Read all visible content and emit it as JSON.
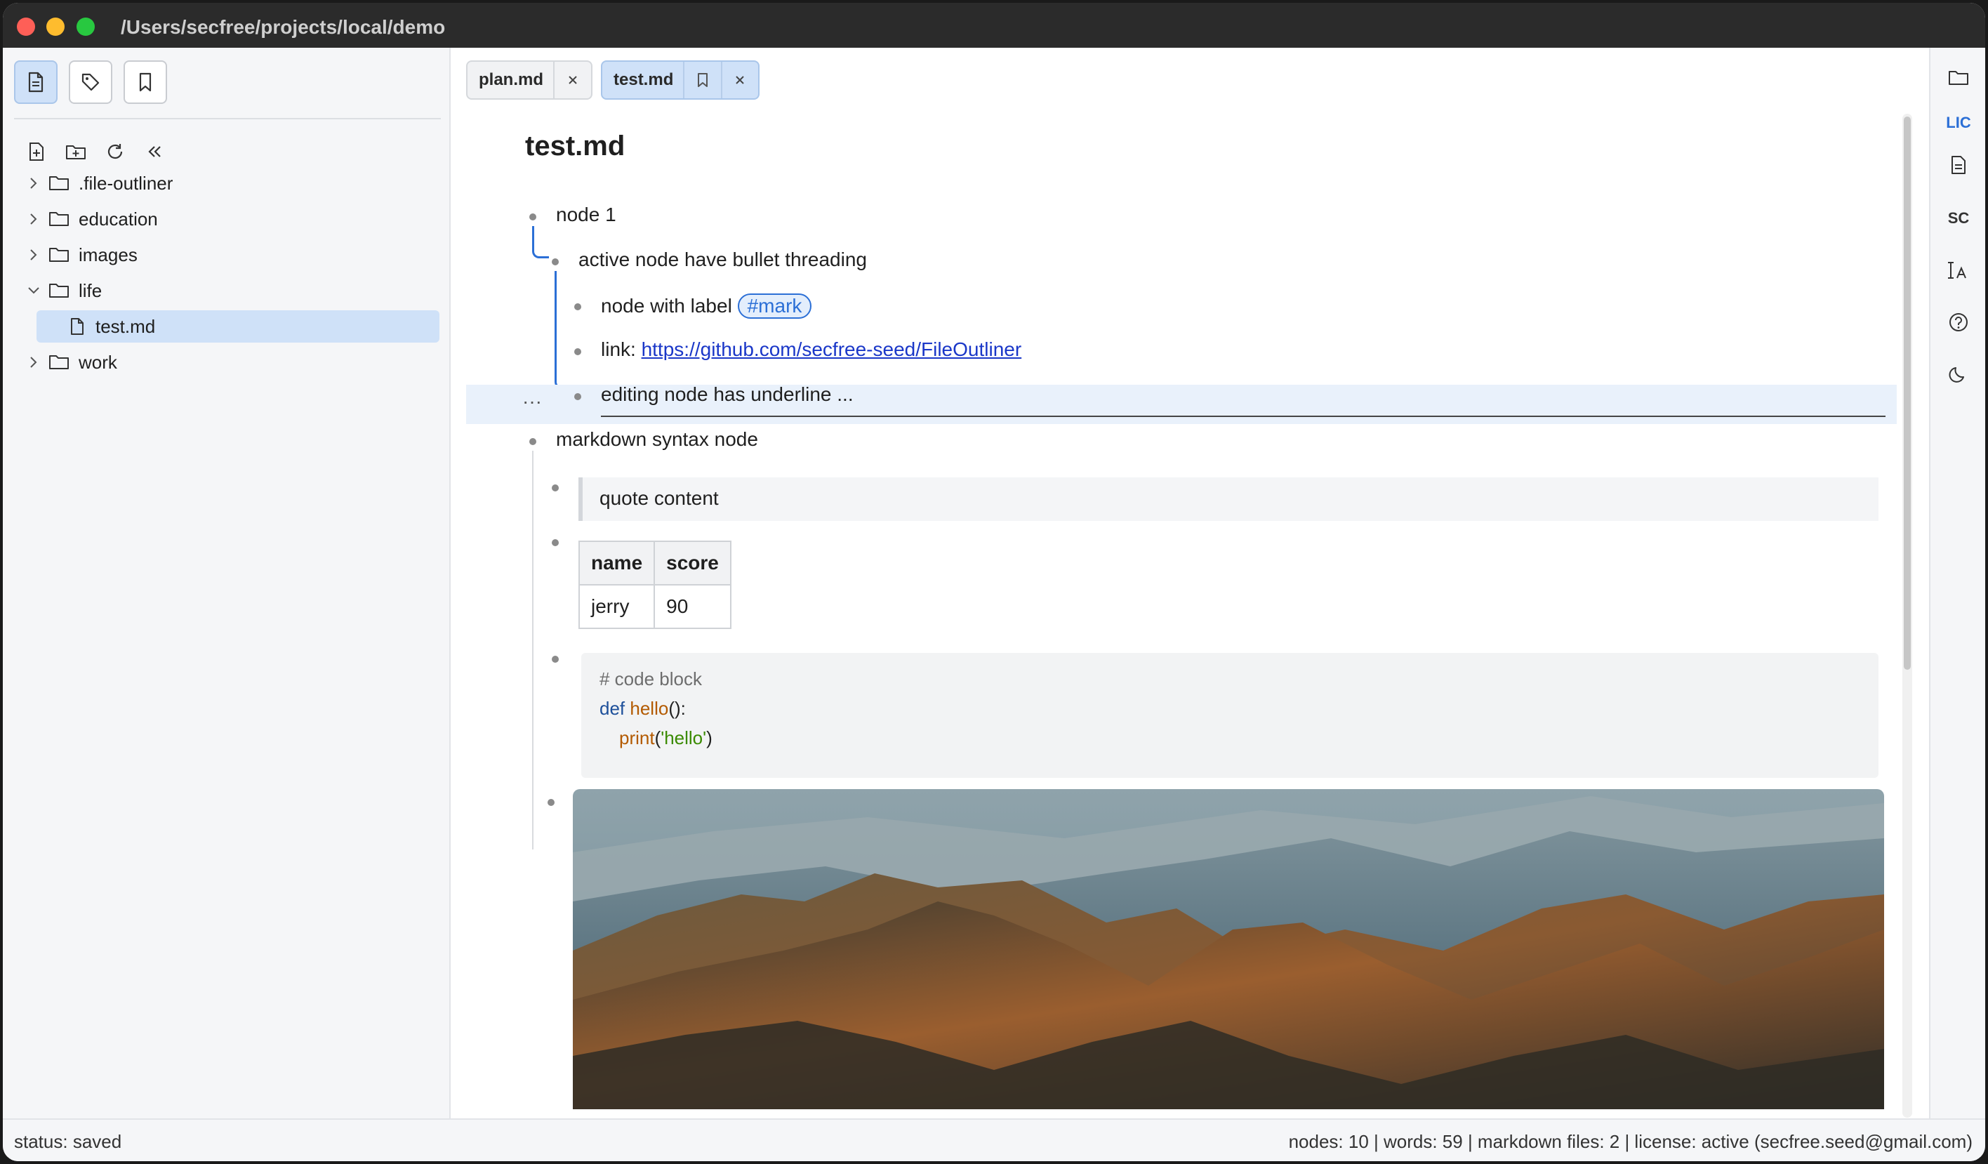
{
  "window": {
    "title": "/Users/secfree/projects/local/demo"
  },
  "sidebar": {
    "tabs": [
      {
        "icon": "file-icon",
        "active": true
      },
      {
        "icon": "tag-icon",
        "active": false
      },
      {
        "icon": "bookmark-icon",
        "active": false
      }
    ],
    "tools": [
      "new-file-icon",
      "new-folder-icon",
      "refresh-icon",
      "collapse-icon"
    ],
    "tree": [
      {
        "label": ".file-outliner",
        "type": "folder",
        "expanded": false
      },
      {
        "label": "education",
        "type": "folder",
        "expanded": false
      },
      {
        "label": "images",
        "type": "folder",
        "expanded": false
      },
      {
        "label": "life",
        "type": "folder",
        "expanded": true
      },
      {
        "label": "test.md",
        "type": "file",
        "selected": true
      },
      {
        "label": "work",
        "type": "folder",
        "expanded": false
      }
    ]
  },
  "tabs": [
    {
      "label": "plan.md",
      "active": false
    },
    {
      "label": "test.md",
      "active": true
    }
  ],
  "document": {
    "title": "test.md",
    "nodes": {
      "n1": "node 1",
      "n1_1": "active node have bullet threading",
      "n1_1_1": "node with label",
      "n1_1_1_tag": "#mark",
      "n1_1_2_prefix": "link:",
      "n1_1_2_link": "https://github.com/secfree-seed/FileOutliner",
      "n1_1_3": "editing node has underline ...",
      "more": "···",
      "n2": "markdown syntax node",
      "quote": "quote content",
      "table": {
        "headers": [
          "name",
          "score"
        ],
        "rows": [
          [
            "jerry",
            "90"
          ]
        ]
      },
      "code": {
        "comment": "# code block",
        "kw": "def",
        "fn": "hello",
        "sig": "():",
        "print": "print",
        "arg_open": "(",
        "str": "'hello'",
        "arg_close": ")"
      }
    }
  },
  "rail": {
    "items": [
      {
        "icon": "folder-icon"
      },
      {
        "label": "LIC",
        "color": "#2b6fd6"
      },
      {
        "icon": "document-icon"
      },
      {
        "label": "SC",
        "color": "#333333"
      },
      {
        "icon": "font-size-icon"
      },
      {
        "icon": "help-icon"
      },
      {
        "icon": "dark-mode-icon"
      }
    ]
  },
  "status": {
    "left": "status: saved",
    "right": "nodes: 10 | words: 59 | markdown files: 2 | license: active (secfree.seed@gmail.com)"
  },
  "colors": {
    "accent": "#2b6fd6",
    "link": "#1a37c8",
    "selection": "#cfe1f8"
  }
}
